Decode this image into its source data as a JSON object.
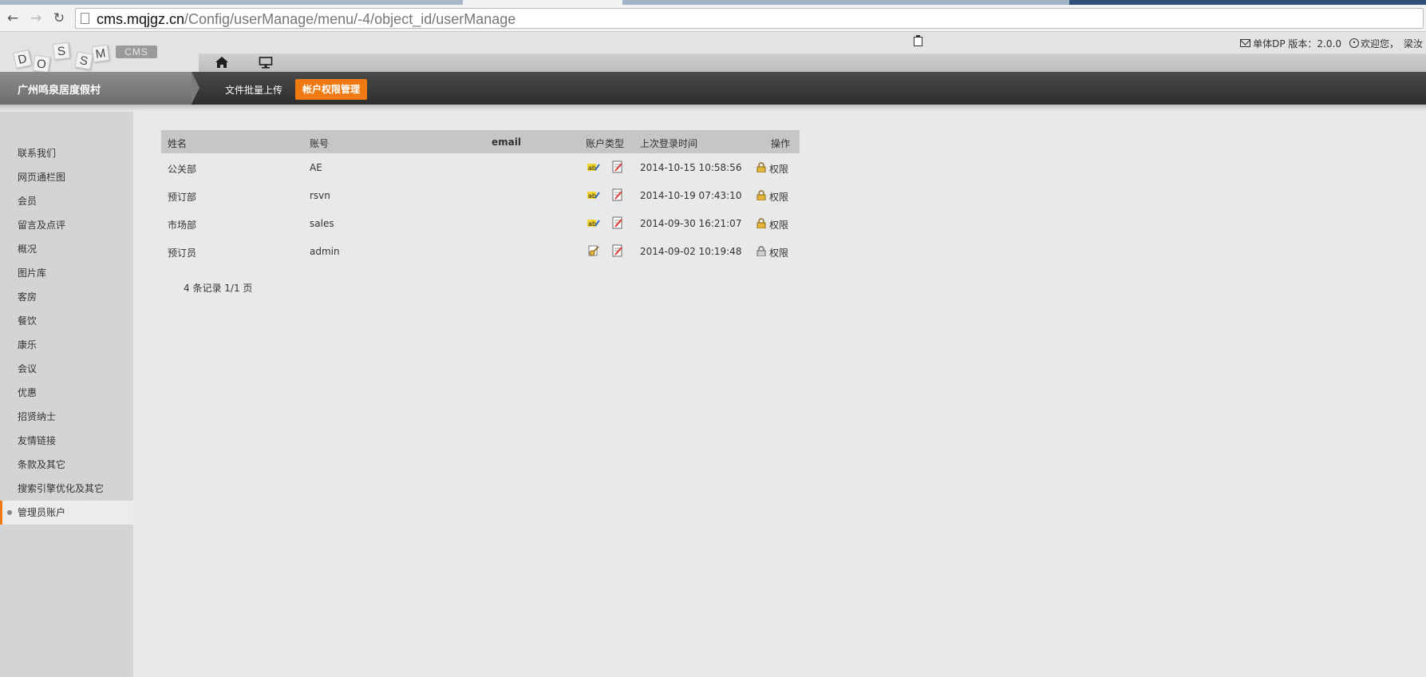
{
  "browser": {
    "url_host": "cms.mqjgz.cn",
    "url_path": "/Config/userManage/menu/-4/object_id/userManage"
  },
  "header": {
    "logo_letters": [
      "D",
      "O",
      "S",
      "S",
      "M"
    ],
    "cms_badge": "CMS",
    "site_title": "广州鸣泉居度假村",
    "menu": {
      "upload_label": "文件批量上传",
      "account_label": "帐户权限管理"
    },
    "top_right": {
      "version_text": "单体DP 版本：2.0.0",
      "welcome_text": "欢迎您，",
      "user_name": "梁汝"
    }
  },
  "sidebar": {
    "items": [
      "联系我们",
      "网页通栏图",
      "会员",
      "留言及点评",
      "概况",
      "图片库",
      "客房",
      "餐饮",
      "康乐",
      "会议",
      "优惠",
      "招贤纳士",
      "友情链接",
      "条款及其它",
      "搜索引擎优化及其它",
      "管理员账户"
    ],
    "active_index": 15
  },
  "table": {
    "headers": {
      "name": "姓名",
      "account": "账号",
      "email": "email",
      "type": "账户类型",
      "last_login": "上次登录时间",
      "action": "操作"
    },
    "rows": [
      {
        "name": "公关部",
        "account": "AE",
        "email": "",
        "last_login": "2014-10-15 10:58:56",
        "action": "权限",
        "type_icon": "edit-text-icon",
        "lock": "locked"
      },
      {
        "name": "预订部",
        "account": "rsvn",
        "email": "",
        "last_login": "2014-10-19 07:43:10",
        "action": "权限",
        "type_icon": "edit-text-icon",
        "lock": "locked"
      },
      {
        "name": "市场部",
        "account": "sales",
        "email": "",
        "last_login": "2014-09-30 16:21:07",
        "action": "权限",
        "type_icon": "edit-text-icon",
        "lock": "locked"
      },
      {
        "name": "预订员",
        "account": "admin",
        "email": "",
        "last_login": "2014-09-02 10:19:48",
        "action": "权限",
        "type_icon": "admin-key-icon",
        "lock": "unlocked"
      }
    ],
    "pager": "4 条记录 1/1 页"
  },
  "colors": {
    "accent": "#f07a12",
    "dark_bar": "#3a3a3a",
    "sidebar_bg": "#d4d4d4",
    "main_bg": "#e9e9e9"
  }
}
